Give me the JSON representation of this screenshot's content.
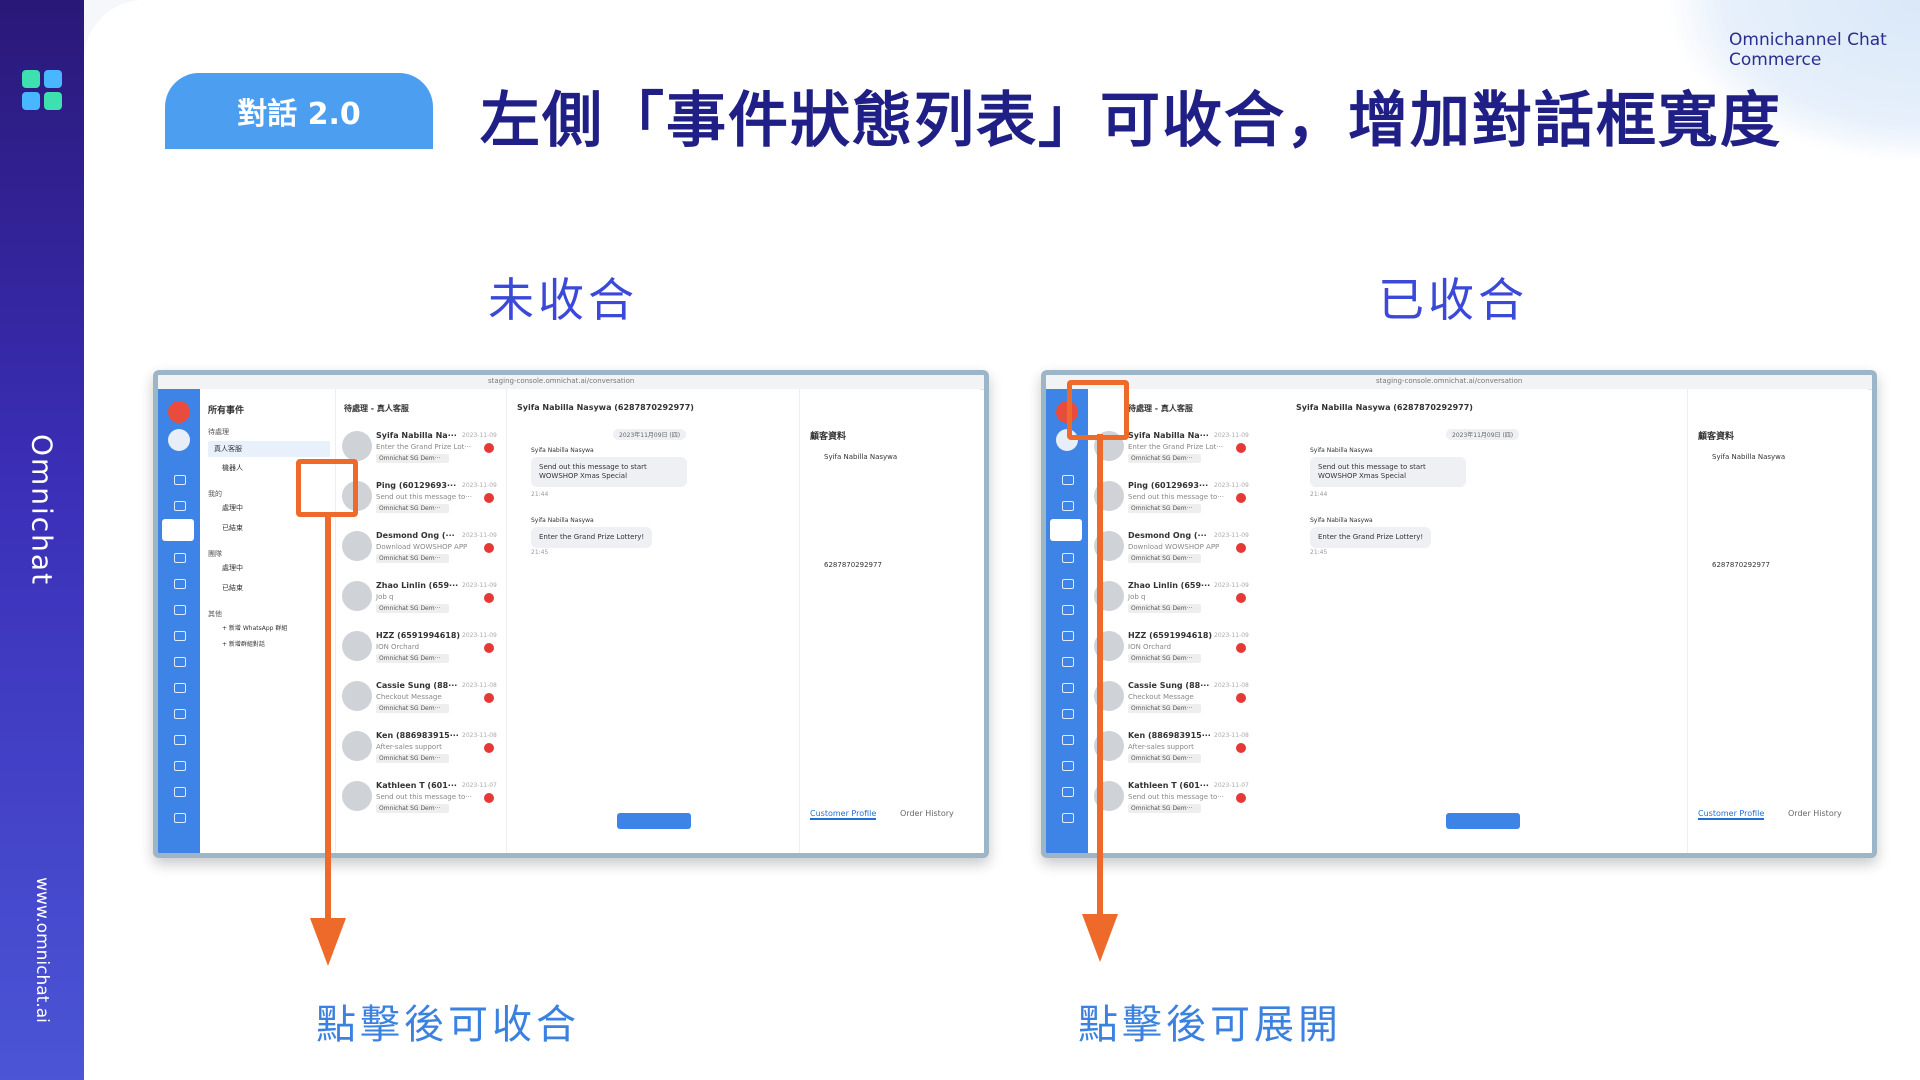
{
  "sidebar": {
    "brand_vertical": "Omnichat",
    "url": "www.omnichat.ai"
  },
  "brand": {
    "line1": "Omnichannel Chat",
    "line2": "Commerce"
  },
  "badge": "對話 2.0",
  "title": "左側「事件狀態列表」可收合，增加對話框寬度",
  "left": {
    "subtitle": "未收合",
    "caption": "點擊後可收合"
  },
  "right": {
    "subtitle": "已收合",
    "caption": "點擊後可展開"
  },
  "app": {
    "url": "staging-console.omnichat.ai/conversation",
    "panel": {
      "header": "所有事件",
      "group1": "待處理",
      "item_human": "真人客服",
      "item_bot": "機器人",
      "group2": "我的",
      "processing": "處理中",
      "done": "已結束",
      "group3": "團隊",
      "group4": "其他",
      "add_wa": "+ 新增 WhatsApp 群組",
      "add_group": "+ 新增群組對話"
    },
    "list_header": "待處理 - 真人客服",
    "rows": [
      {
        "name": "Syifa Nabilla Na···",
        "date": "2023-11-09",
        "msg": "Enter the Grand Prize Lot···",
        "tag": "Omnichat SG Dem···"
      },
      {
        "name": "Ping (60129693···",
        "date": "2023-11-09",
        "msg": "Send out this message to···",
        "tag": "Omnichat SG Dem···"
      },
      {
        "name": "Desmond Ong (···",
        "date": "2023-11-09",
        "msg": "Download WOWSHOP APP",
        "tag": "Omnichat SG Dem···"
      },
      {
        "name": "Zhao Linlin (659···",
        "date": "2023-11-09",
        "msg": "Job q",
        "tag": "Omnichat SG Dem···"
      },
      {
        "name": "HZZ (6591994618)",
        "date": "2023-11-09",
        "msg": "ION Orchard",
        "tag": "Omnichat SG Dem···"
      },
      {
        "name": "Cassie Sung (88···",
        "date": "2023-11-08",
        "msg": "Checkout Message",
        "tag": "Omnichat SG Dem···"
      },
      {
        "name": "Ken (886983915···",
        "date": "2023-11-08",
        "msg": "After-sales support",
        "tag": "Omnichat SG Dem···"
      },
      {
        "name": "Kathleen T (601···",
        "date": "2023-11-07",
        "msg": "Send out this message to···",
        "tag": "Omnichat SG Dem···"
      }
    ],
    "chat": {
      "header": "Syifa Nabilla Nasywa (6287870292977)",
      "date": "2023年11月09日 (四)",
      "sender": "Syifa Nabilla Nasywa",
      "msg1": "Send out this message to start WOWSHOP Xmas Special",
      "time1": "21:44",
      "msg2": "Enter the Grand Prize Lottery!",
      "time2": "21:45"
    },
    "info": {
      "title": "顧客資料",
      "name": "Syifa Nabilla Nasywa",
      "phone": "6287870292977",
      "tab1": "Customer Profile",
      "tab2": "Order History"
    }
  }
}
